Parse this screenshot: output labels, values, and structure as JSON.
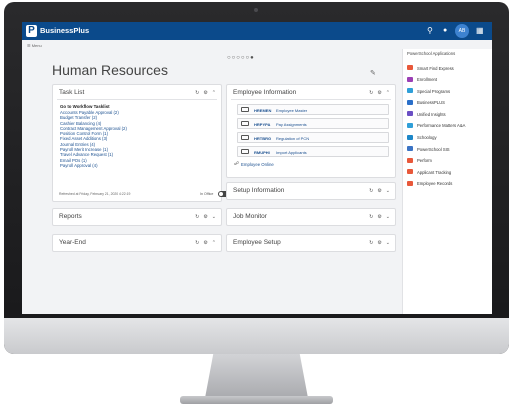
{
  "topbar": {
    "app_name": "BusinessPlus",
    "logo_letter": "P",
    "avatar_initials": "AB",
    "icons": [
      "search-icon",
      "help-icon",
      "app-grid-icon"
    ]
  },
  "menu_label": "Menu",
  "carousel_dots": "○○○○○●",
  "page_title": "Human Resources",
  "panels": {
    "task_list": {
      "title": "Task List",
      "subtitle": "Go to Workflow Tasklist",
      "items": [
        "Accounts Payable Approval (2)",
        "Budget Transfer (2)",
        "Cashier Balancing (4)",
        "Contract Management Approval (2)",
        "Position Control Form (1)",
        "Fixed Asset Additions (3)",
        "Journal Entries (4)",
        "Payroll Merit Increase (1)",
        "Travel Advance Request (1)",
        "Email POs (1)",
        "Payroll Approval (4)"
      ],
      "footer": "Refreshed at Friday, February 21, 2020 4:22:19",
      "toggle_label": "In Office"
    },
    "employee_information": {
      "title": "Employee Information",
      "rows": [
        {
          "code": "HREMEN",
          "name": "Employee Master"
        },
        {
          "code": "HRPYPA",
          "name": "Pay Assignments"
        },
        {
          "code": "HRTBRG",
          "name": "Regulation of PCN"
        },
        {
          "code": "RMUPHI",
          "name": "Import Applicants"
        }
      ],
      "online_label": "Employee Online"
    },
    "setup_information": {
      "title": "Setup Information"
    },
    "reports": {
      "title": "Reports"
    },
    "job_monitor": {
      "title": "Job Monitor"
    },
    "year_end": {
      "title": "Year-End"
    },
    "employee_setup": {
      "title": "Employee Setup"
    }
  },
  "sidebar": {
    "title": "PowerSchool Applications",
    "items": [
      {
        "label": "Smart Find Express",
        "color": "#e8583a"
      },
      {
        "label": "Enrollment",
        "color": "#9b3fb5"
      },
      {
        "label": "Special Programs",
        "color": "#2f9fd8"
      },
      {
        "label": "BusinessPLUS",
        "color": "#2a6fc9"
      },
      {
        "label": "Unified Insights",
        "color": "#6a4fc4"
      },
      {
        "label": "Performance Matters A&A",
        "color": "#2f9fd8"
      },
      {
        "label": "Schoology",
        "color": "#1d87c8"
      },
      {
        "label": "PowerSchool SIS",
        "color": "#3b73c4"
      },
      {
        "label": "Perform",
        "color": "#e8583a"
      },
      {
        "label": "Applicant Tracking",
        "color": "#e8583a"
      },
      {
        "label": "Employee Records",
        "color": "#e8583a"
      }
    ]
  },
  "colors": {
    "topbar": "#0b4a8b",
    "link": "#1a4f8f"
  }
}
